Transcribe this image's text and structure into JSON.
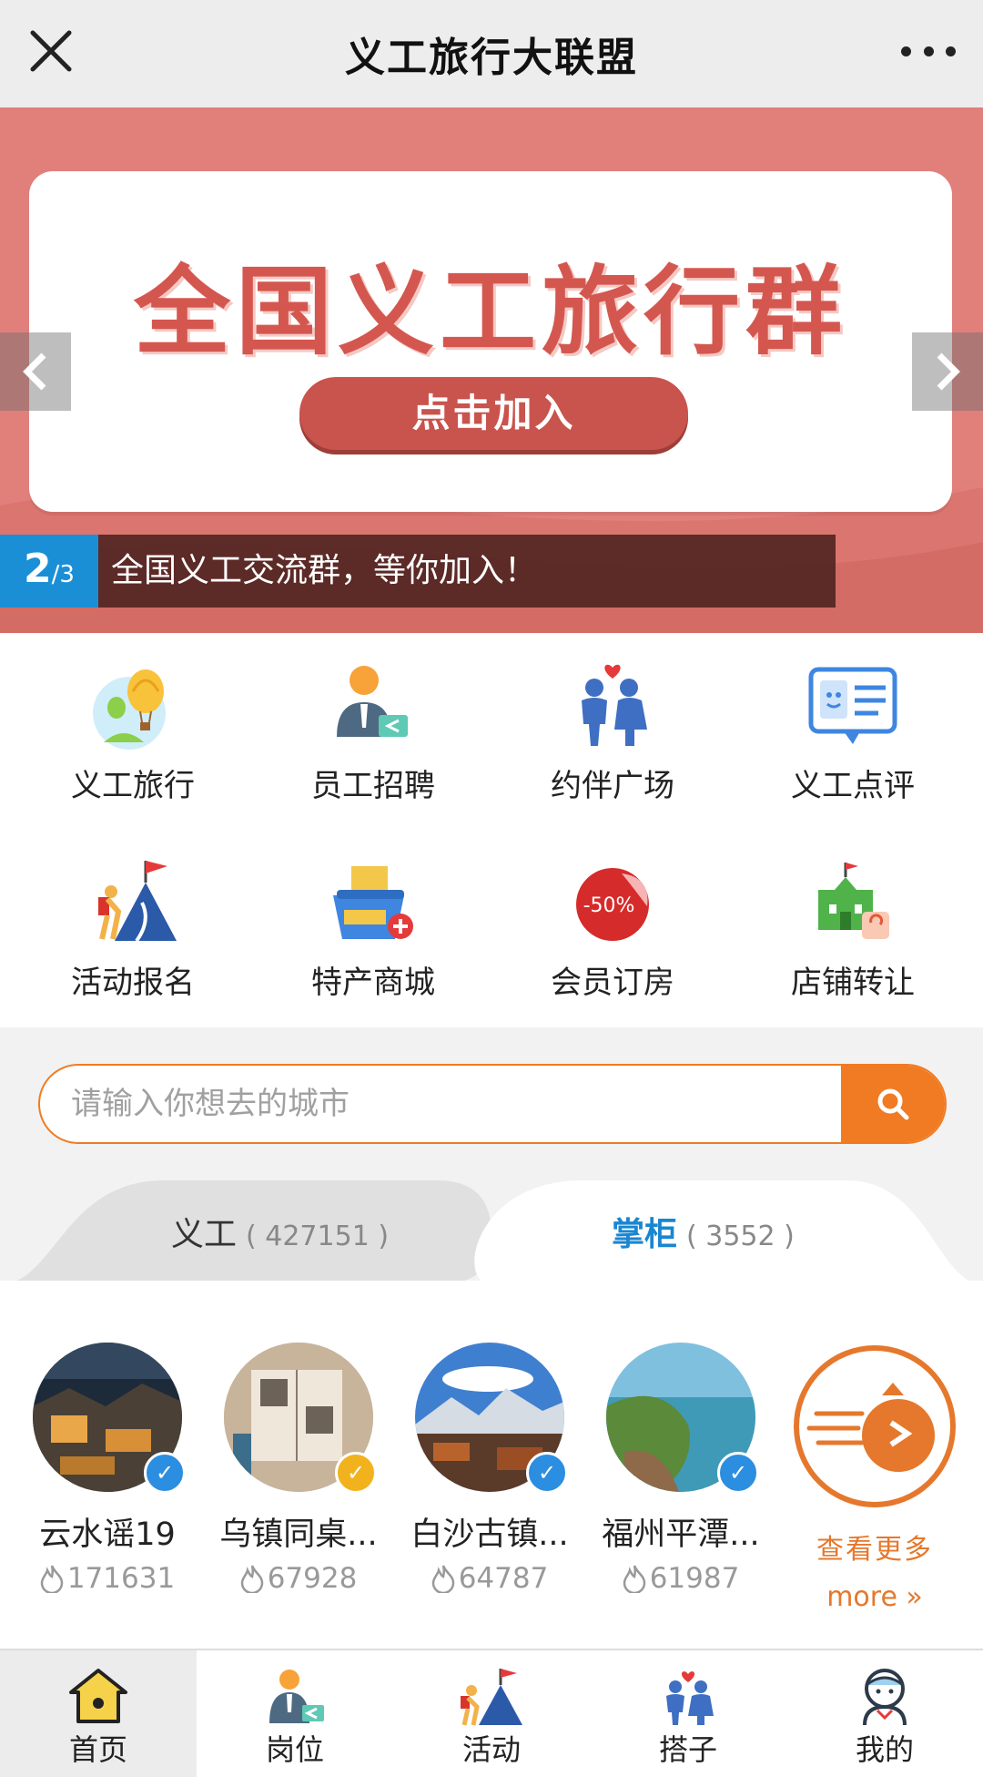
{
  "titlebar": {
    "title": "义工旅行大联盟",
    "close_icon": "close-icon",
    "more_icon": "more-icon"
  },
  "banner": {
    "headline": "全国义工旅行群",
    "button_label": "点击加入",
    "current_slide": "2",
    "total_slides": "/3",
    "caption": "全国义工交流群，等你加入！",
    "color": "#e17f7b"
  },
  "menu": {
    "items": [
      {
        "label": "义工旅行",
        "icon": "balloon-icon"
      },
      {
        "label": "员工招聘",
        "icon": "recruit-icon"
      },
      {
        "label": "约伴广场",
        "icon": "companions-icon"
      },
      {
        "label": "义工点评",
        "icon": "review-icon"
      },
      {
        "label": "活动报名",
        "icon": "climb-flag-icon"
      },
      {
        "label": "特产商城",
        "icon": "basket-icon"
      },
      {
        "label": "会员订房",
        "icon": "discount-sticker-icon"
      },
      {
        "label": "店铺转让",
        "icon": "shop-transfer-icon"
      }
    ]
  },
  "search": {
    "placeholder": "请输入你想去的城市",
    "accent": "#f07b23"
  },
  "tabs": [
    {
      "name": "义工",
      "count": "( 427151 )"
    },
    {
      "name": "掌柜",
      "count": "( 3552 )"
    }
  ],
  "hosts": [
    {
      "name": "云水谣19",
      "heat": "171631",
      "badge": "blue"
    },
    {
      "name": "乌镇同桌...",
      "heat": "67928",
      "badge": "gold"
    },
    {
      "name": "白沙古镇...",
      "heat": "64787",
      "badge": "blue"
    },
    {
      "name": "福州平潭...",
      "heat": "61987",
      "badge": "blue"
    }
  ],
  "more": {
    "label_cn": "查看更多",
    "label_en": "more »"
  },
  "bottom_nav": [
    {
      "label": "首页",
      "icon": "home-icon"
    },
    {
      "label": "岗位",
      "icon": "job-icon"
    },
    {
      "label": "活动",
      "icon": "activity-icon"
    },
    {
      "label": "搭子",
      "icon": "partner-icon"
    },
    {
      "label": "我的",
      "icon": "profile-icon"
    }
  ]
}
